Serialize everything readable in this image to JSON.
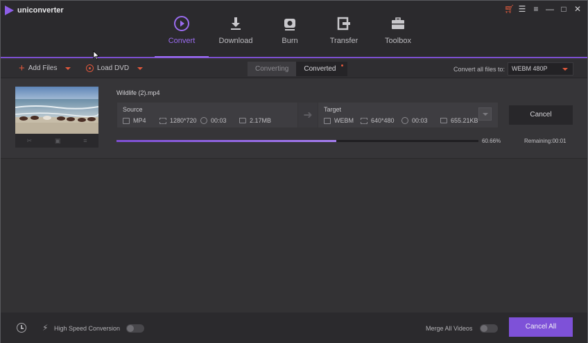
{
  "app": {
    "title": "uniconverter"
  },
  "window_controls": [
    "cart-icon",
    "account-icon",
    "menu-icon",
    "minimize-icon",
    "maximize-icon",
    "close-icon"
  ],
  "nav": [
    {
      "label": "Convert",
      "icon": "convert-icon",
      "active": true
    },
    {
      "label": "Download",
      "icon": "download-icon",
      "active": false
    },
    {
      "label": "Burn",
      "icon": "burn-icon",
      "active": false
    },
    {
      "label": "Transfer",
      "icon": "transfer-icon",
      "active": false
    },
    {
      "label": "Toolbox",
      "icon": "toolbox-icon",
      "active": false
    }
  ],
  "toolbar": {
    "add_files": "Add Files",
    "load_dvd": "Load DVD",
    "tab_converting": "Converting",
    "tab_converted": "Converted",
    "convert_all_label": "Convert all files to:",
    "convert_all_value": "WEBM 480P"
  },
  "file": {
    "name": "Wildlife (2).mp4",
    "source": {
      "heading": "Source",
      "format": "MP4",
      "resolution": "1280*720",
      "duration": "00:03",
      "size": "2.17MB"
    },
    "target": {
      "heading": "Target",
      "format": "WEBM",
      "resolution": "640*480",
      "duration": "00:03",
      "size": "655.21KB"
    },
    "cancel_label": "Cancel",
    "progress_percent": 60.66,
    "progress_text": "60.66%",
    "remaining_text": "Remaining:00:01"
  },
  "footer": {
    "high_speed_label": "High Speed Conversion",
    "high_speed_on": false,
    "merge_label": "Merge All Videos",
    "merge_on": false,
    "cancel_all_label": "Cancel All"
  },
  "colors": {
    "accent": "#7e51d8",
    "toolbar_icon": "#e2583c",
    "background": "#333234"
  }
}
